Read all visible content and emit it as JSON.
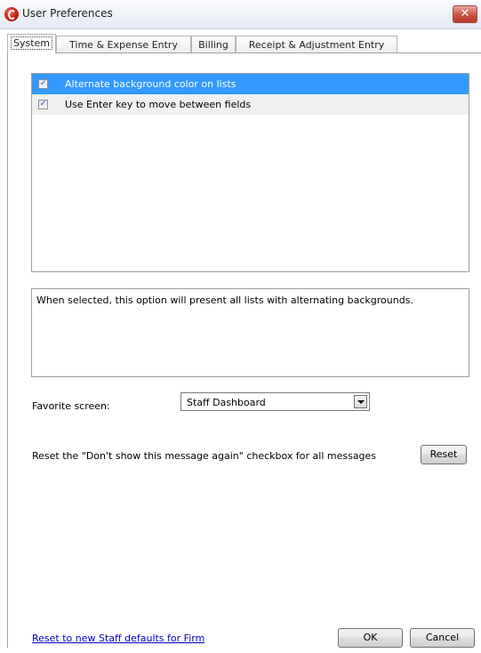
{
  "window": {
    "title": "User Preferences",
    "close_label": "✕"
  },
  "tabs": [
    {
      "label": "System"
    },
    {
      "label": "Time & Expense Entry"
    },
    {
      "label": "Billing"
    },
    {
      "label": "Receipt & Adjustment Entry"
    }
  ],
  "options": [
    {
      "label": "Alternate background color on lists",
      "checked": true
    },
    {
      "label": "Use Enter key to move between fields",
      "checked": true
    }
  ],
  "description": "When selected, this option will present all lists with alternating backgrounds.",
  "favorite": {
    "label": "Favorite screen:",
    "value": "Staff Dashboard"
  },
  "reset": {
    "label": "Reset the \"Don't show this message again\" checkbox for all messages",
    "button": "Reset"
  },
  "footer": {
    "link": "Reset to new Staff defaults for Firm",
    "ok": "OK",
    "cancel": "Cancel"
  },
  "colors": {
    "selection": "#3399ff",
    "link": "#0000cc"
  }
}
